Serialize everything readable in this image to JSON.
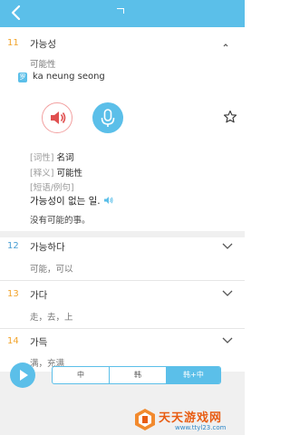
{
  "colors": {
    "accent": "#5bbfe9",
    "rank_highlight": "#f2a42b",
    "rank_normal": "#4a9fd4",
    "speaker_red": "#e05050",
    "watermark_orange": "#e85c12"
  },
  "entries": [
    {
      "rank": "11",
      "word": "가능성",
      "translation": "可能性",
      "badge": "罗",
      "romanization": "ka neung seong",
      "expanded": true,
      "details": [
        {
          "tag": "[词性]",
          "value": "名词"
        },
        {
          "tag": "[释义]",
          "value": "可能性"
        },
        {
          "tag": "[短语/例句]",
          "value": ""
        }
      ],
      "example": {
        "korean": "가능성이 없는 일.",
        "chinese": "没有可能的事。"
      }
    },
    {
      "rank": "12",
      "word": "가능하다",
      "translation": "可能，可以"
    },
    {
      "rank": "13",
      "word": "가다",
      "translation": "走，去，上"
    },
    {
      "rank": "14",
      "word": "가득",
      "translation": "满，充满"
    }
  ],
  "bottom": {
    "modes": [
      "中",
      "韩",
      "韩+中"
    ],
    "selected_mode": "韩+中"
  },
  "watermark": {
    "title": "天天游戏网",
    "url": "www.ttyl23.com"
  },
  "icons": [
    "back-arrow-icon",
    "speaker-icon",
    "microphone-icon",
    "star-outline-icon",
    "chevron-down-icon",
    "play-icon"
  ]
}
